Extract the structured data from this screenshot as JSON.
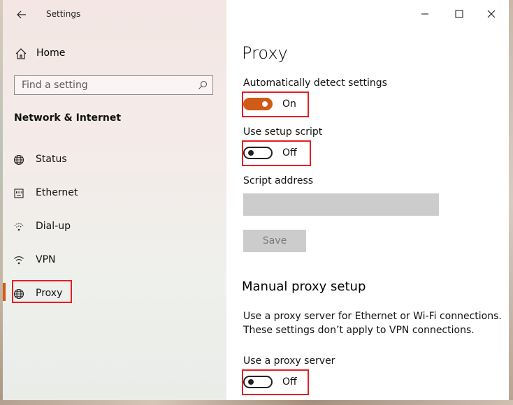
{
  "window": {
    "title": "Settings",
    "controls": [
      "minimize-icon",
      "maximize-icon",
      "close-icon"
    ]
  },
  "sidebar": {
    "home_label": "Home",
    "search_placeholder": "Find a setting",
    "section_title": "Network & Internet",
    "items": [
      {
        "label": "Status",
        "icon": "globe-icon"
      },
      {
        "label": "Ethernet",
        "icon": "ethernet-icon"
      },
      {
        "label": "Dial-up",
        "icon": "dialup-icon"
      },
      {
        "label": "VPN",
        "icon": "vpn-icon"
      },
      {
        "label": "Proxy",
        "icon": "globe-icon",
        "selected": true
      }
    ]
  },
  "main": {
    "title": "Proxy",
    "auto_detect": {
      "label": "Automatically detect settings",
      "state": "On"
    },
    "setup_script": {
      "label": "Use setup script",
      "state": "Off"
    },
    "script_address": {
      "label": "Script address",
      "value": ""
    },
    "save_label": "Save",
    "manual_title": "Manual proxy setup",
    "manual_desc_1": "Use a proxy server for Ethernet or Wi-Fi connections.",
    "manual_desc_2": "These settings don’t apply to VPN connections.",
    "proxy_server": {
      "label": "Use a proxy server",
      "state": "Off"
    }
  },
  "colors": {
    "accent": "#d05a17",
    "highlight": "#e41e24",
    "disabled_fill": "#cccccc"
  }
}
